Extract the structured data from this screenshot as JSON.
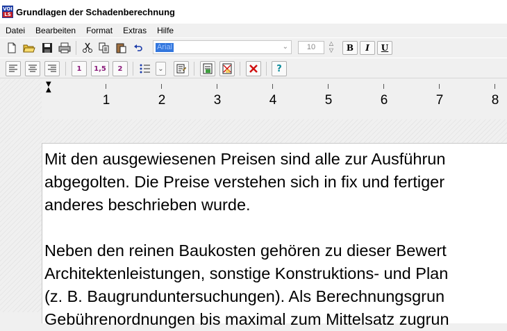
{
  "window": {
    "title": "Grundlagen der Schadenberechnung",
    "icon_top": "VOI",
    "icon_bottom": "LS"
  },
  "menu": [
    "Datei",
    "Bearbeiten",
    "Format",
    "Extras",
    "Hilfe"
  ],
  "toolbar": {
    "font_name": "Arial",
    "font_size": "10",
    "bold_label": "B",
    "italic_label": "I",
    "underline_label": "U",
    "spacing_1": "1",
    "spacing_15": "1,5",
    "spacing_2": "2",
    "help_label": "?"
  },
  "ruler": {
    "numbers": [
      "1",
      "2",
      "3",
      "4",
      "5",
      "6",
      "7",
      "8"
    ]
  },
  "document": {
    "lines": [
      "Mit den ausgewiesenen Preisen sind alle zur Ausführun",
      "abgegolten. Die Preise verstehen sich in fix und fertiger",
      "anderes beschrieben wurde.",
      "",
      "Neben den reinen Baukosten gehören zu dieser Bewert",
      "Architektenleistungen, sonstige Konstruktions- und Plan",
      "(z. B. Baugrunduntersuchungen). Als Berechnungsgrun",
      "Gebührenordnungen bis maximal zum Mittelsatz zugrun"
    ]
  },
  "colors": {
    "selection": "#3377dd",
    "spacing_text": "#8a1a7a",
    "help_icon": "#0a8a9a",
    "delete_icon": "#d01010"
  }
}
